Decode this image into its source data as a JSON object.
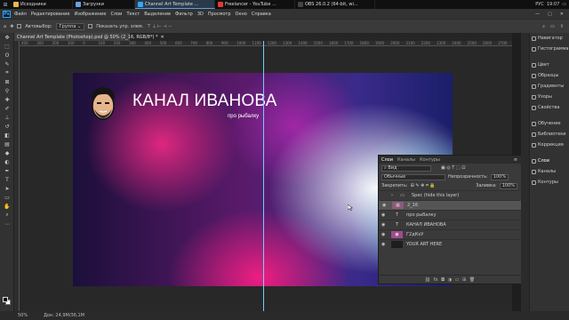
{
  "taskbar": {
    "tabs": [
      {
        "label": "Исходники",
        "color": "#e8b84a"
      },
      {
        "label": "Загрузки",
        "color": "#6aa0e0"
      },
      {
        "label": "Channel Art Template ...",
        "color": "#31a8ff"
      },
      {
        "label": "Freelancer - YouTube ...",
        "color": "#e03a3a"
      },
      {
        "label": "OBS 26.0.2 (64-bit, wi...",
        "color": "#444444"
      }
    ],
    "lang": "РУС",
    "time": "19:07"
  },
  "menubar": {
    "logo": "Ps",
    "items": [
      "Файл",
      "Редактирование",
      "Изображение",
      "Слои",
      "Текст",
      "Выделение",
      "Фильтр",
      "3D",
      "Просмотр",
      "Окно",
      "Справка"
    ]
  },
  "optbar": {
    "auto_select": "Автовыбор:",
    "group": "Группа",
    "transform": "Показать упр. элем."
  },
  "document": {
    "tab_title": "Channel Art Template (Photoshop).psd @ 50% (2_16, RGB/8*) *"
  },
  "ruler": {
    "ticks": [
      "400",
      "300",
      "200",
      "100",
      "0",
      "100",
      "200",
      "300",
      "400",
      "500",
      "600",
      "700",
      "800",
      "900",
      "1000",
      "1100",
      "1200",
      "1300",
      "1400",
      "1500",
      "1600",
      "1700",
      "1800",
      "1900",
      "2000",
      "2100",
      "2200",
      "2300",
      "2400",
      "2500",
      "2600",
      "2700"
    ]
  },
  "canvas": {
    "title": "КАНАЛ ИВАНОВА",
    "subtitle": "про рыбалку"
  },
  "layers_panel": {
    "tabs": [
      "Слои",
      "Каналы",
      "Контуры"
    ],
    "kind": "Вид",
    "blend": "Обычные",
    "opacity_label": "Непрозрачность:",
    "opacity": "100%",
    "lock_label": "Закрепить:",
    "fill_label": "Заливка:",
    "fill": "100%",
    "layers": [
      {
        "name": "Spec (hide this layer)",
        "thumb": "folder",
        "visible": false,
        "selected": false
      },
      {
        "name": "2_16",
        "thumb": "image",
        "visible": true,
        "selected": true
      },
      {
        "name": "про рыбалку",
        "thumb": "T",
        "visible": true,
        "selected": false
      },
      {
        "name": "КАНАЛ ИВАНОВА",
        "thumb": "T",
        "visible": true,
        "selected": false
      },
      {
        "name": "Г2дКхУ",
        "thumb": "photo",
        "visible": true,
        "selected": false
      },
      {
        "name": "YOUR ART HERE",
        "thumb": "dark",
        "visible": true,
        "selected": false
      }
    ]
  },
  "dock": {
    "items": [
      {
        "label": "Навигатор",
        "active": false
      },
      {
        "label": "Гистограмма",
        "active": false
      },
      {
        "label": "Цвет",
        "active": false
      },
      {
        "label": "Образцы",
        "active": false
      },
      {
        "label": "Градиенты",
        "active": false
      },
      {
        "label": "Узоры",
        "active": false
      },
      {
        "label": "Свойства",
        "active": false
      },
      {
        "label": "Обучение",
        "active": false
      },
      {
        "label": "Библиотеки",
        "active": false
      },
      {
        "label": "Коррекция",
        "active": false
      },
      {
        "label": "Слои",
        "active": true
      },
      {
        "label": "Каналы",
        "active": false
      },
      {
        "label": "Контуры",
        "active": false
      }
    ]
  },
  "status": {
    "zoom": "50%",
    "doc": "Док: 24,9М/36,1М"
  }
}
